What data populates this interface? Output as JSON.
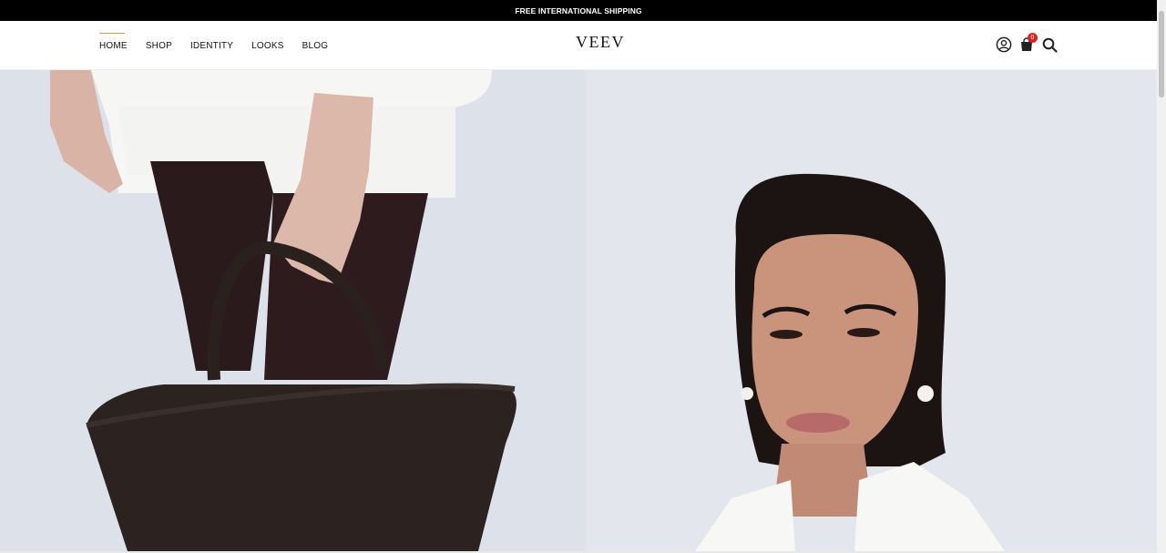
{
  "announcement": {
    "text": "FREE INTERNATIONAL SHIPPING"
  },
  "nav": {
    "items": [
      {
        "label": "HOME",
        "active": true
      },
      {
        "label": "SHOP",
        "active": false
      },
      {
        "label": "IDENTITY",
        "active": false
      },
      {
        "label": "LOOKS",
        "active": false
      },
      {
        "label": "BLOG",
        "active": false
      }
    ]
  },
  "brand": {
    "logo": "VEEV"
  },
  "header_icons": {
    "account": "user-circle-icon",
    "cart": "shopping-bag-icon",
    "cart_count": "0",
    "search": "search-icon"
  },
  "hero": {
    "left_image": "model-holding-woven-bag",
    "right_image": "model-portrait"
  },
  "colors": {
    "announce_bg": "#000000",
    "accent": "#c8a24a",
    "badge": "#dd2222"
  }
}
